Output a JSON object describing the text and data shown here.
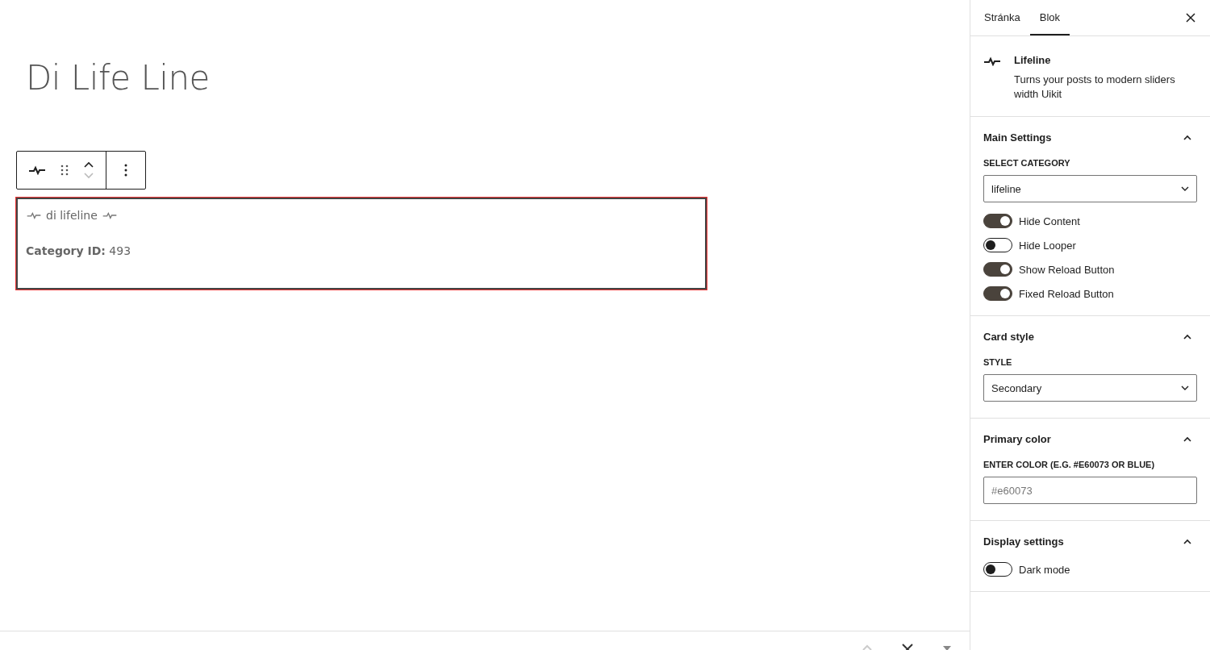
{
  "post_title": "Di Life Line",
  "block": {
    "title": "di lifeline",
    "text": "**Category ID:** 493"
  },
  "tabs": [
    {
      "label": "Stránka",
      "selected": false
    },
    {
      "label": "Blok",
      "selected": true
    }
  ],
  "block_info": {
    "name": "Lifeline",
    "description": "Turns your posts to modern sliders width Uikit"
  },
  "panels": [
    {
      "title": "Main Settings",
      "expanded": true,
      "controls": [
        {
          "kind": "select",
          "label": "SELECT CATEGORY",
          "value": "lifeline"
        },
        {
          "kind": "toggle",
          "label": "Hide Content",
          "on": true
        },
        {
          "kind": "toggle",
          "label": "Hide Looper",
          "on": false
        },
        {
          "kind": "toggle",
          "label": "Show Reload Button",
          "on": true
        },
        {
          "kind": "toggle",
          "label": "Fixed Reload Button",
          "on": true
        }
      ]
    },
    {
      "title": "Card style",
      "expanded": true,
      "controls": [
        {
          "kind": "select",
          "label": "STYLE",
          "value": "Secondary"
        }
      ]
    },
    {
      "title": "Primary color",
      "expanded": true,
      "controls": [
        {
          "kind": "text",
          "label": "ENTER COLOR (E.G. #E60073 OR BLUE)",
          "placeholder": "#e60073"
        }
      ]
    },
    {
      "title": "Display settings",
      "expanded": true,
      "controls": [
        {
          "kind": "toggle",
          "label": "Dark mode",
          "on": false
        }
      ]
    }
  ]
}
